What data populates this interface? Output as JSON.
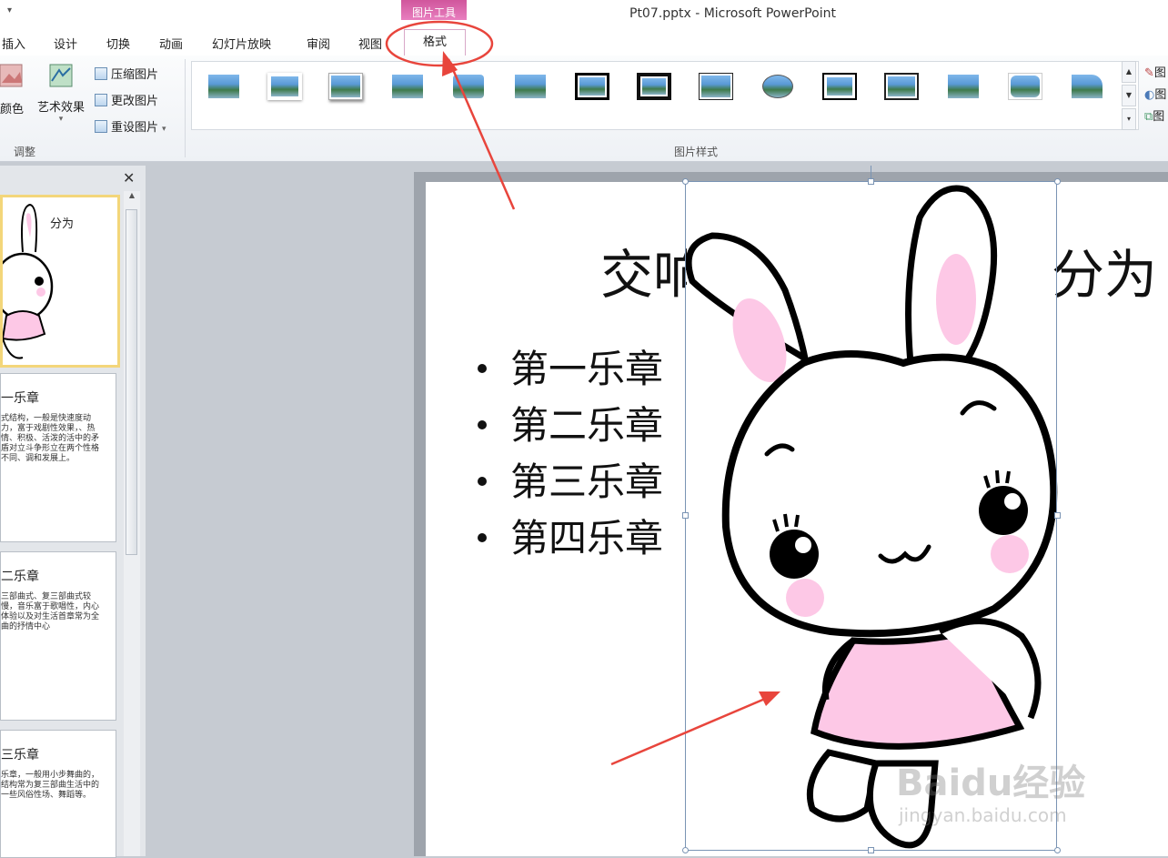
{
  "window": {
    "title": "Pt07.pptx - Microsoft PowerPoint",
    "context_tab": "图片工具"
  },
  "tabs": [
    {
      "label": "插入"
    },
    {
      "label": "设计"
    },
    {
      "label": "切换"
    },
    {
      "label": "动画"
    },
    {
      "label": "幻灯片放映"
    },
    {
      "label": "审阅"
    },
    {
      "label": "视图"
    },
    {
      "label": "格式"
    }
  ],
  "ribbon": {
    "adjust": {
      "color_label": "颜色",
      "artistic_label": "艺术效果",
      "compress_label": "压缩图片",
      "change_label": "更改图片",
      "reset_label": "重设图片",
      "group_label": "调整"
    },
    "styles": {
      "group_label": "图片样式"
    },
    "side_letter": "图"
  },
  "slides_panel": {
    "close_glyph": "✕",
    "slides": [
      {
        "title": "分为",
        "body": ""
      },
      {
        "title": "一乐章",
        "body": "式结构，一般是快速度动力，富于戏剧性效果，、热情、积极、活泼的活中的矛盾对立斗争形立在两个性格不同、调和发展上。"
      },
      {
        "title": "二乐章",
        "body": "三部曲式、复三部曲式较慢，音乐富于歌唱性，内心体验以及对生活首章常为全曲的抒情中心"
      },
      {
        "title": "三乐章",
        "body": "乐章，一般用小步舞曲的，结构常为复三部曲生活中的一些风俗性场、舞蹈等。"
      }
    ]
  },
  "slide": {
    "title_left": "交响",
    "title_right": "分为",
    "bullets": [
      "第一乐章",
      "第二乐章",
      "第三乐章",
      "第四乐章"
    ]
  },
  "watermark": {
    "text": "Baidu经验",
    "url": "jingyan.baidu.com"
  },
  "colors": {
    "context_tab": "#d0569c",
    "annotation": "#e8453c",
    "bunny_pink": "#fdc8e6"
  }
}
